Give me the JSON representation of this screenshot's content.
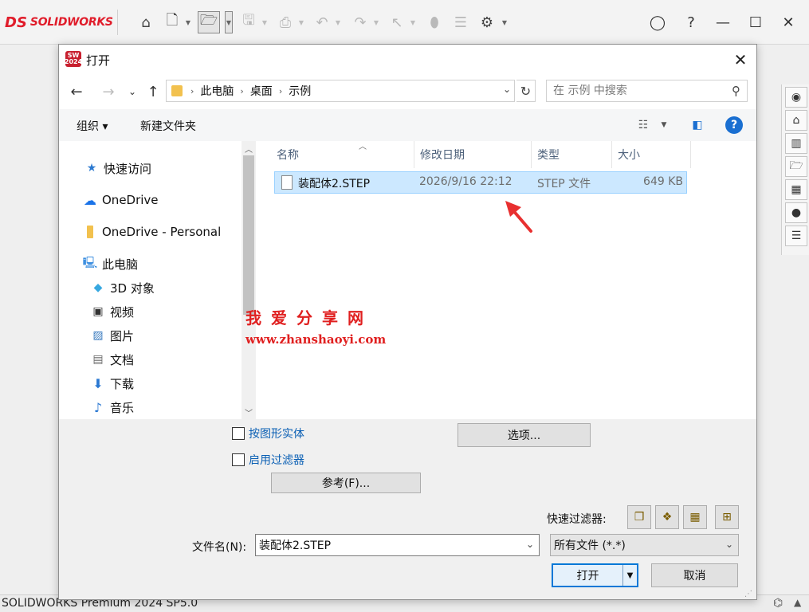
{
  "app": {
    "logo_ds": "DS",
    "logo_name": "SOLIDWORKS",
    "status_text": "SOLIDWORKS Premium 2024 SP5.0",
    "accent_red": "#e01c2a"
  },
  "toolbar": {
    "icons": [
      "home-icon",
      "new-document-icon",
      "open-icon",
      "save-icon",
      "print-icon",
      "undo-icon",
      "redo-icon",
      "select-icon",
      "rebuild-icon",
      "file-properties-icon",
      "options-icon"
    ],
    "window_icons": [
      "user-icon",
      "help-icon",
      "minimize-icon",
      "maximize-icon",
      "close-icon"
    ]
  },
  "dialog": {
    "title": "打开",
    "app_badge": "SW 2024",
    "breadcrumb": [
      "此电脑",
      "桌面",
      "示例"
    ],
    "search_placeholder": "在 示例 中搜索",
    "organize_label": "组织 ▾",
    "new_folder_label": "新建文件夹",
    "nav_items": [
      {
        "label": "快速访问",
        "icon": "star-icon"
      },
      {
        "label": "OneDrive",
        "icon": "cloud-icon"
      },
      {
        "label": "OneDrive - Personal",
        "icon": "folder-icon"
      },
      {
        "label": "此电脑",
        "icon": "computer-icon"
      },
      {
        "label": "3D 对象",
        "icon": "cube-icon"
      },
      {
        "label": "视频",
        "icon": "video-icon"
      },
      {
        "label": "图片",
        "icon": "picture-icon"
      },
      {
        "label": "文档",
        "icon": "document-icon"
      },
      {
        "label": "下载",
        "icon": "download-icon"
      },
      {
        "label": "音乐",
        "icon": "music-icon"
      }
    ],
    "columns": {
      "name": "名称",
      "date": "修改日期",
      "type": "类型",
      "size": "大小"
    },
    "files": [
      {
        "name": "装配体2.STEP",
        "date": "2026/9/16 22:12",
        "type": "STEP 文件",
        "size": "649 KB"
      }
    ],
    "watermark": {
      "cn": "我爱分享网",
      "url": "www.zhanshaoyi.com"
    },
    "options": {
      "checkbox_graphics": "按图形实体",
      "checkbox_filter": "启用过滤器",
      "options_button": "选项...",
      "reference_button": "参考(F)...",
      "quick_filter_label": "快速过滤器:",
      "filename_label": "文件名(N):",
      "filename_value": "装配体2.STEP",
      "filetype_value": "所有文件 (*.*)",
      "open_button": "打开",
      "cancel_button": "取消"
    }
  }
}
